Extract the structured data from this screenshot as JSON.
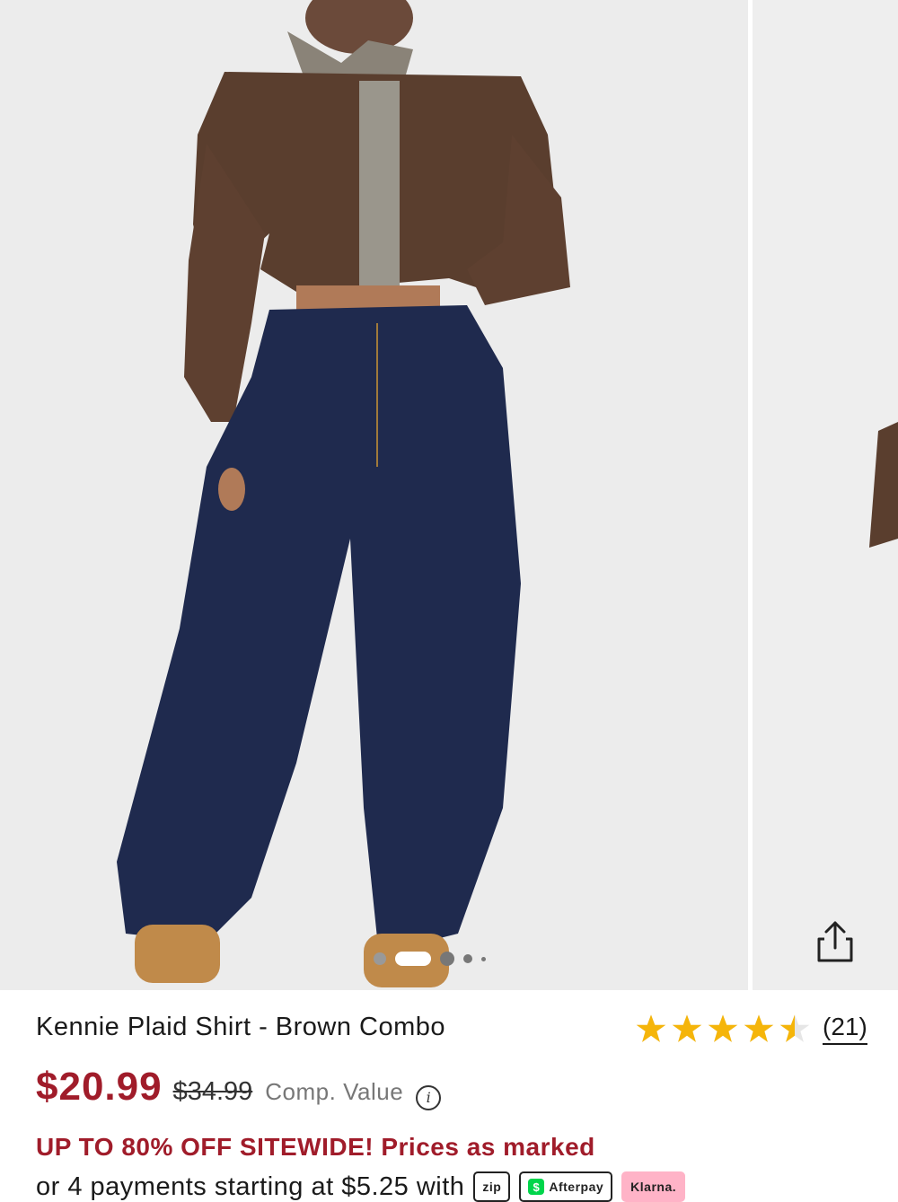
{
  "product": {
    "title": "Kennie Plaid Shirt - Brown Combo",
    "price": "$20.99",
    "original_price": "$34.99",
    "comp_value_label": "Comp. Value",
    "rating_value": 4.5,
    "rating_max": 5,
    "review_count": "(21)"
  },
  "gallery": {
    "image_count": 5,
    "active_index": 1
  },
  "promo": {
    "text": "UP TO 80% OFF SITEWIDE! Prices as marked"
  },
  "payments": {
    "text": "or 4 payments starting at $5.25 with",
    "providers": [
      {
        "label": "zip",
        "icon": "zip-logo-icon"
      },
      {
        "label": "Afterpay",
        "icon": "cash-app-afterpay-icon"
      },
      {
        "label": "Klarna.",
        "icon": "klarna-logo-icon"
      }
    ]
  },
  "icons": {
    "share": "share-icon",
    "info": "info-icon",
    "star": "star-icon"
  },
  "colors": {
    "price": "#a01c2a",
    "star": "#f5b50a",
    "promo": "#a01c2a"
  }
}
